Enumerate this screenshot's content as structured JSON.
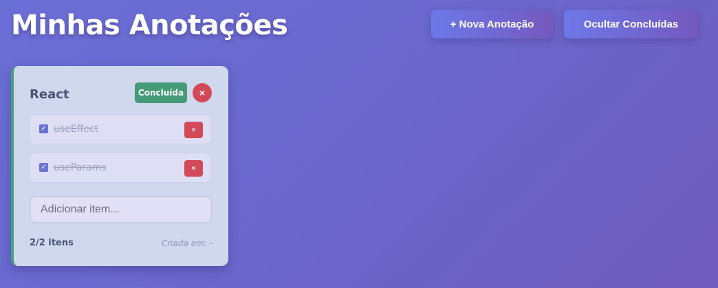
{
  "header": {
    "title": "Minhas Anotações",
    "new_note_label": "+ Nova Anotação",
    "hide_done_label": "Ocultar Concluídas"
  },
  "note": {
    "title": "React",
    "status_label": "Concluída",
    "delete_icon": "×",
    "items": [
      {
        "text": "useEffect",
        "checked": true,
        "delete_icon": "×"
      },
      {
        "text": "useParams",
        "checked": true,
        "delete_icon": "×"
      }
    ],
    "add_placeholder": "Adicionar item...",
    "add_value": "",
    "count_label": "2/2 itens",
    "created_label": "Criada em: -"
  },
  "colors": {
    "accent": "#6a6fd6",
    "done": "#459a78",
    "danger": "#d4495a"
  }
}
